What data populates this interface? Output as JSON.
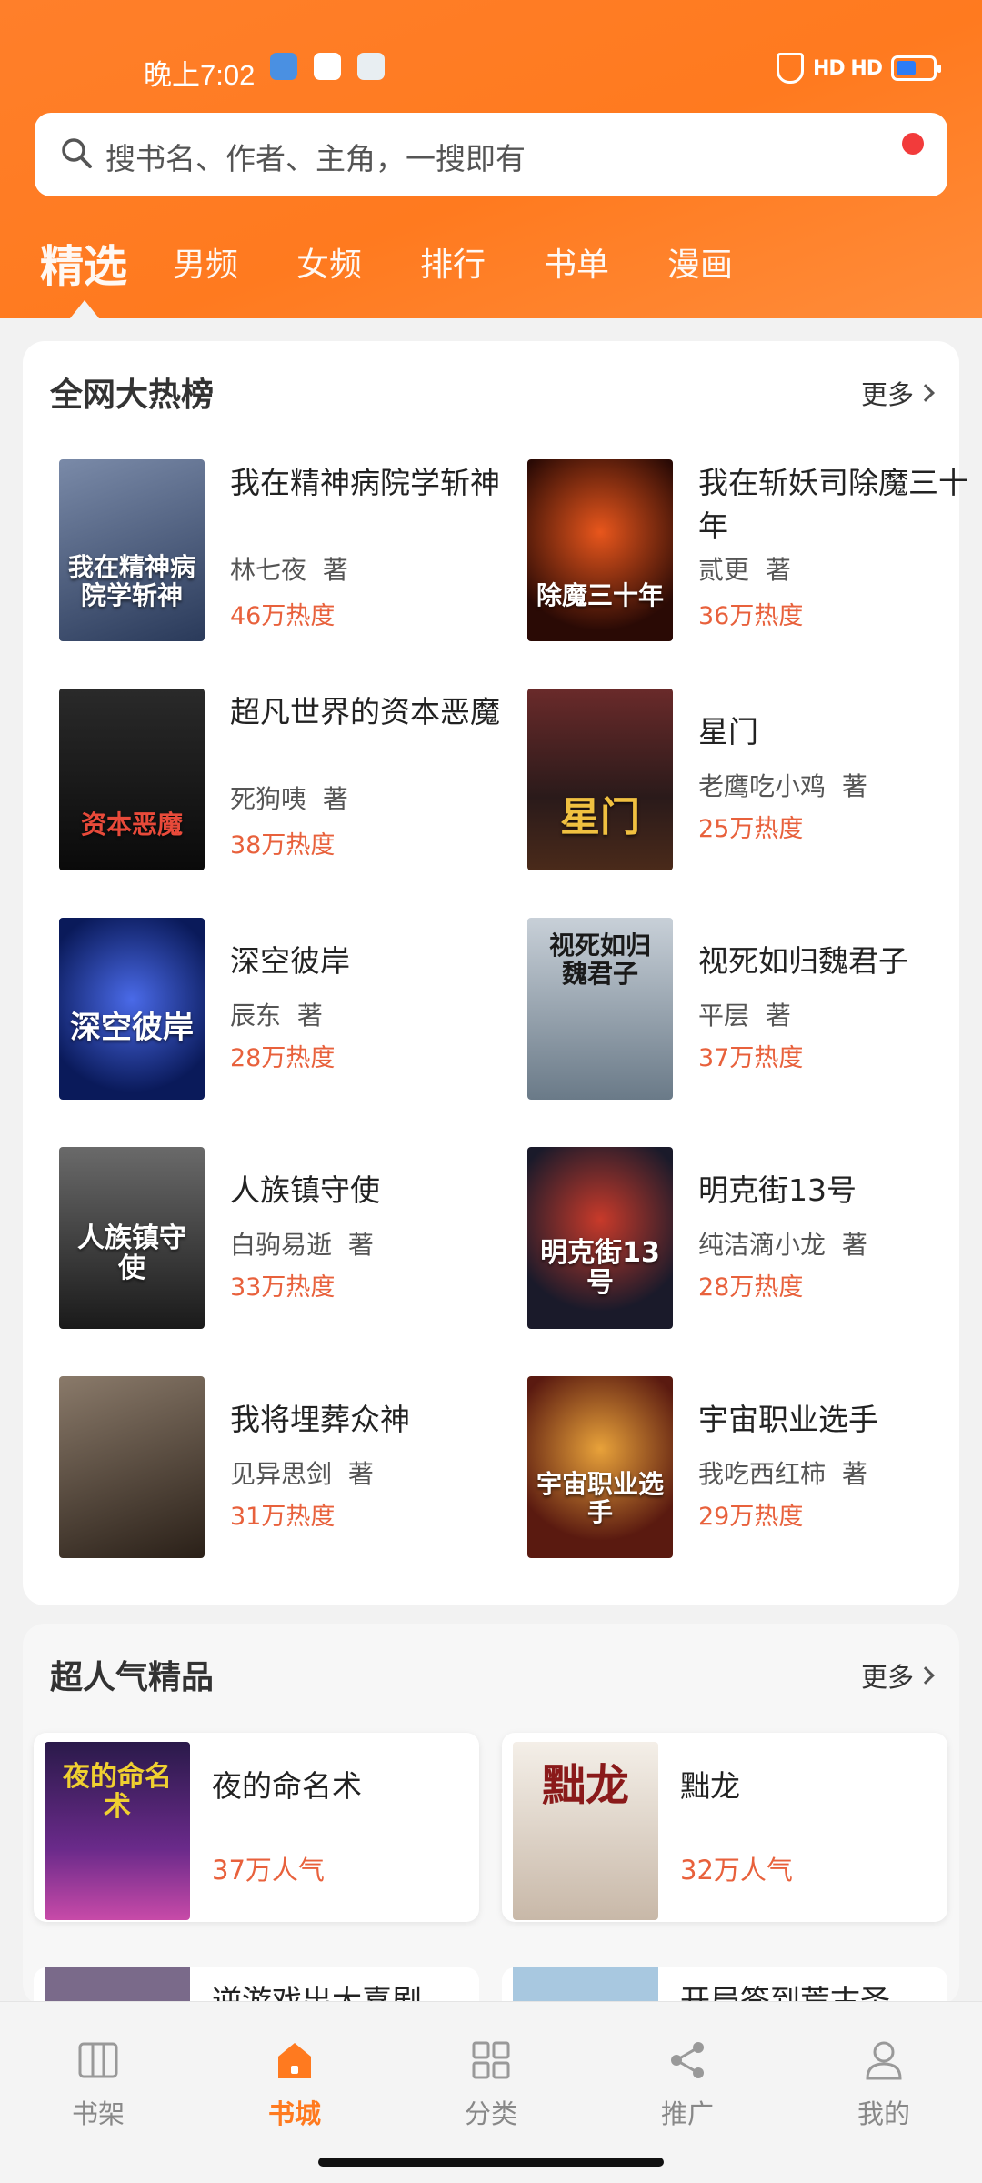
{
  "status_bar": {
    "time": "晚上7:02",
    "signal": "HD HD",
    "battery_color": "#2d7cf6"
  },
  "search": {
    "placeholder": "搜书名、作者、主角，一搜即有"
  },
  "tabs": [
    "精选",
    "男频",
    "女频",
    "排行",
    "书单",
    "漫画"
  ],
  "hot_list": {
    "title": "全网大热榜",
    "more_label": "更多",
    "books": [
      {
        "title": "我在精神病院学斩神",
        "author": "林七夜",
        "author_suffix": "著",
        "heat": "46万热度",
        "cover_text": "我在精神病院学斩神",
        "cover_color": "#3a4a6a"
      },
      {
        "title": "我在斩妖司除魔三十年",
        "author": "贰更",
        "author_suffix": "著",
        "heat": "36万热度",
        "cover_text": "除魔三十年",
        "cover_color": "#3b1510"
      },
      {
        "title": "超凡世界的资本恶魔",
        "author": "死狗咦",
        "author_suffix": "著",
        "heat": "38万热度",
        "cover_text": "资本恶魔",
        "cover_color": "#1a1a1a"
      },
      {
        "title": "星门",
        "author": "老鹰吃小鸡",
        "author_suffix": "著",
        "heat": "25万热度",
        "cover_text": "星门",
        "cover_color": "#5a3030"
      },
      {
        "title": "深空彼岸",
        "author": "辰东",
        "author_suffix": "著",
        "heat": "28万热度",
        "cover_text": "深空彼岸",
        "cover_color": "#1d2b7a"
      },
      {
        "title": "视死如归魏君子",
        "author": "平层",
        "author_suffix": "著",
        "heat": "37万热度",
        "cover_text": "视死如归 魏君子",
        "cover_color": "#8a9aa8"
      },
      {
        "title": "人族镇守使",
        "author": "白驹易逝",
        "author_suffix": "著",
        "heat": "33万热度",
        "cover_text": "人族镇守使",
        "cover_color": "#3a3a3a"
      },
      {
        "title": "明克街13号",
        "author": "纯洁滴小龙",
        "author_suffix": "著",
        "heat": "28万热度",
        "cover_text": "明克街13号",
        "cover_color": "#2a2a3a"
      },
      {
        "title": "我将埋葬众神",
        "author": "见异思剑",
        "author_suffix": "著",
        "heat": "31万热度",
        "cover_text": "",
        "cover_color": "#4a3a2a"
      },
      {
        "title": "宇宙职业选手",
        "author": "我吃西红柿",
        "author_suffix": "著",
        "heat": "29万热度",
        "cover_text": "宇宙职业选手",
        "cover_color": "#5a1a10"
      }
    ]
  },
  "popular": {
    "title": "超人气精品",
    "more_label": "更多",
    "items": [
      {
        "title": "夜的命名术",
        "popularity": "37万人气",
        "cover_text": "夜的命名术",
        "cover_color": "#3a1f5a"
      },
      {
        "title": "黜龙",
        "popularity": "32万人气",
        "cover_text": "黜龙",
        "cover_color": "#e8e2da"
      }
    ],
    "peek_titles": [
      "逆游戏出大喜剧",
      "开局签到荒古圣"
    ]
  },
  "bottom_nav": [
    {
      "label": "书架",
      "icon": "bookshelf-icon"
    },
    {
      "label": "书城",
      "icon": "bookstore-icon",
      "active": true
    },
    {
      "label": "分类",
      "icon": "category-icon"
    },
    {
      "label": "推广",
      "icon": "share-icon"
    },
    {
      "label": "我的",
      "icon": "profile-icon"
    }
  ],
  "colors": {
    "accent": "#ff7a1f",
    "heat": "#e8613c"
  }
}
